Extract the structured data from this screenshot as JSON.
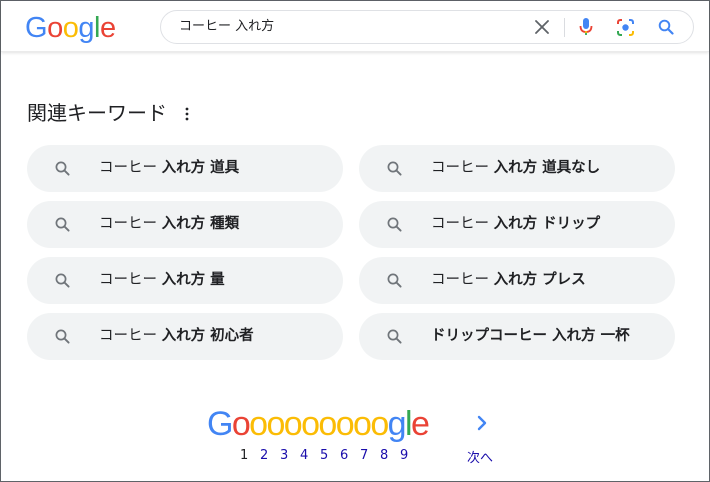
{
  "header": {
    "logo_text": "Google",
    "search": {
      "value": "コーヒー 入れ方"
    }
  },
  "related": {
    "title": "関連キーワード",
    "items": [
      {
        "base": "コーヒー ",
        "bold": "入れ方 道具"
      },
      {
        "base": "コーヒー ",
        "bold": "入れ方 道具なし"
      },
      {
        "base": "コーヒー ",
        "bold": "入れ方 種類"
      },
      {
        "base": "コーヒー ",
        "bold": "入れ方 ドリップ"
      },
      {
        "base": "コーヒー ",
        "bold": "入れ方 量"
      },
      {
        "base": "コーヒー ",
        "bold": "入れ方 プレス"
      },
      {
        "base": "コーヒー ",
        "bold": "入れ方 初心者"
      },
      {
        "base": "",
        "bold": "ドリップコーヒー 入れ方 一杯"
      }
    ]
  },
  "pagination": {
    "logo_text": "Gooooooooogle",
    "pages": [
      "1",
      "2",
      "3",
      "4",
      "5",
      "6",
      "7",
      "8",
      "9"
    ],
    "current_page": "1",
    "next_label": "次へ"
  },
  "colors": {
    "blue": "#4285f4",
    "red": "#ea4335",
    "yellow": "#fbbc05",
    "green": "#34a853",
    "link": "#1a0dab",
    "chip_bg": "#f1f3f4"
  }
}
